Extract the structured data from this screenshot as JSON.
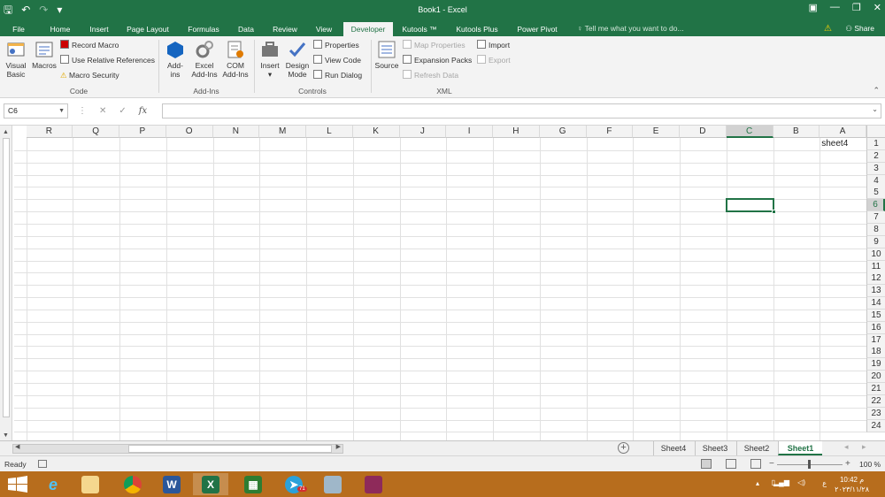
{
  "window": {
    "title": "Book1 - Excel",
    "controls": [
      "▣",
      "—",
      "❐",
      "✕"
    ]
  },
  "qat": {
    "save": "🖫",
    "undo": "↶",
    "redo": "↷",
    "customize": "▾"
  },
  "tabs": [
    {
      "label": "File"
    },
    {
      "label": "Home"
    },
    {
      "label": "Insert"
    },
    {
      "label": "Page Layout"
    },
    {
      "label": "Formulas"
    },
    {
      "label": "Data"
    },
    {
      "label": "Review"
    },
    {
      "label": "View"
    },
    {
      "label": "Developer"
    },
    {
      "label": "Kutools ™"
    },
    {
      "label": "Kutools Plus"
    },
    {
      "label": "Power Pivot"
    }
  ],
  "active_tab": "Developer",
  "tell_me": "Tell me what you want to do...",
  "share": "Share",
  "ribbon": {
    "code": {
      "group_label": "Code",
      "visual_basic": "Visual Basic",
      "macros": "Macros",
      "record_macro": "Record Macro",
      "relative_refs": "Use Relative References",
      "macro_security": "Macro Security"
    },
    "addins": {
      "group_label": "Add-Ins",
      "addins": "Add-ins",
      "excel_addins": "Excel Add-Ins",
      "com_addins": "COM Add-Ins"
    },
    "controls": {
      "group_label": "Controls",
      "insert": "Insert",
      "design_mode": "Design Mode",
      "properties": "Properties",
      "view_code": "View Code",
      "run_dialog": "Run Dialog"
    },
    "xml": {
      "group_label": "XML",
      "source": "Source",
      "map_properties": "Map Properties",
      "expansion_packs": "Expansion Packs",
      "refresh_data": "Refresh Data",
      "import": "Import",
      "export": "Export"
    }
  },
  "formula_bar": {
    "name_box": "C6",
    "value": "",
    "fx": "fx"
  },
  "columns": [
    "R",
    "Q",
    "P",
    "O",
    "N",
    "M",
    "L",
    "K",
    "J",
    "I",
    "H",
    "G",
    "F",
    "E",
    "D",
    "C",
    "B",
    "A"
  ],
  "rows": [
    "1",
    "2",
    "3",
    "4",
    "5",
    "6",
    "7",
    "8",
    "9",
    "10",
    "11",
    "12",
    "13",
    "14",
    "15",
    "16",
    "17",
    "18",
    "19",
    "20",
    "21",
    "22",
    "23",
    "24"
  ],
  "selected_cell": {
    "column": "C",
    "row": "6"
  },
  "cells": [
    {
      "ref": "A1",
      "value": "sheet4"
    }
  ],
  "sheets": [
    {
      "label": "Sheet4"
    },
    {
      "label": "Sheet3"
    },
    {
      "label": "Sheet2"
    },
    {
      "label": "Sheet1"
    }
  ],
  "active_sheet": "Sheet1",
  "status": {
    "ready": "Ready",
    "zoom": "100 %"
  },
  "taskbar": {
    "apps": [
      "start",
      "internet-explorer",
      "file-explorer",
      "chrome",
      "word",
      "excel",
      "calculator",
      "telegram",
      "notes",
      "winrar"
    ],
    "telegram_badge": "71",
    "time": "10:42 م",
    "date": "۲۰۲۳/۱۱/۲۸",
    "lang": "ع"
  }
}
